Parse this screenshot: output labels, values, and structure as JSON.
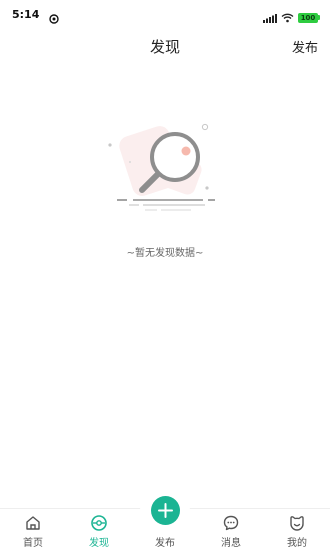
{
  "status_bar": {
    "time": "5:14",
    "battery": "100",
    "icons": [
      "app-notification-icon",
      "signal-icon",
      "wifi-icon",
      "battery-icon"
    ]
  },
  "header": {
    "title": "发现",
    "publish_label": "发布"
  },
  "empty_state": {
    "message": "~暂无发现数据~",
    "icon": "magnifier-illustration"
  },
  "bottom_nav": {
    "items": [
      {
        "label": "首页",
        "icon": "home-icon"
      },
      {
        "label": "发现",
        "icon": "discover-icon",
        "active": true
      },
      {
        "label": "发布",
        "icon": "plus-icon"
      },
      {
        "label": "消息",
        "icon": "message-icon"
      },
      {
        "label": "我的",
        "icon": "profile-icon"
      }
    ]
  },
  "colors": {
    "accent": "#1bb493",
    "text": "#222222",
    "muted": "#666666"
  }
}
